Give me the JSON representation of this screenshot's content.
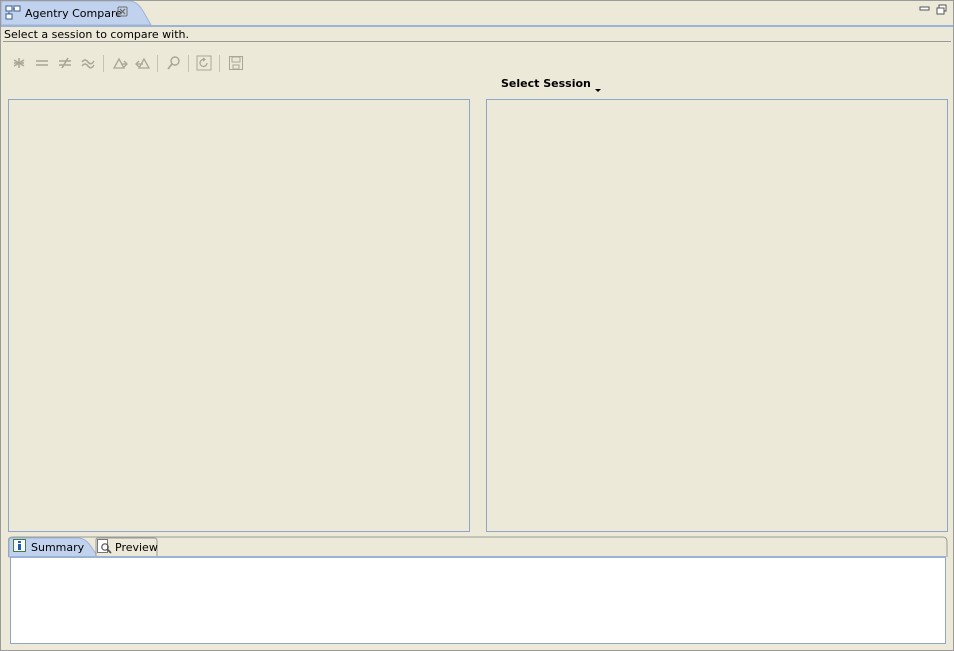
{
  "view": {
    "title": "Agentry Compare",
    "tab_icon": "compare-view-icon",
    "close_icon": "close-icon",
    "minimize_icon": "minimize-icon",
    "restore_icon": "restore-icon"
  },
  "status": {
    "message": "Select a session to compare with."
  },
  "toolbar": {
    "buttons": [
      {
        "name": "show-all-differences",
        "icon": "asterisk-icon",
        "enabled": false
      },
      {
        "name": "show-identical",
        "icon": "equals-icon",
        "enabled": false
      },
      {
        "name": "show-different",
        "icon": "not-equal-icon",
        "enabled": false
      },
      {
        "name": "show-similar",
        "icon": "approx-equal-icon",
        "enabled": false
      },
      {
        "name": "copy-left-to-right",
        "icon": "copy-right-icon",
        "enabled": false
      },
      {
        "name": "copy-right-to-left",
        "icon": "copy-left-icon",
        "enabled": false
      },
      {
        "name": "find",
        "icon": "search-icon",
        "enabled": false
      },
      {
        "name": "refresh",
        "icon": "refresh-icon",
        "enabled": false
      },
      {
        "name": "save",
        "icon": "save-icon",
        "enabled": false
      }
    ]
  },
  "session_selector": {
    "label": "Select Session",
    "icon": "chevron-down-icon"
  },
  "bottom_tabs": [
    {
      "label": "Summary",
      "icon": "info-icon",
      "active": true
    },
    {
      "label": "Preview",
      "icon": "preview-icon",
      "active": false
    }
  ],
  "colors": {
    "background": "#ece9d8",
    "pane_border": "#8fa6c8",
    "active_tab": "#c1d2ee",
    "content_background": "#ffffff",
    "disabled_icon": "#a8a696"
  }
}
